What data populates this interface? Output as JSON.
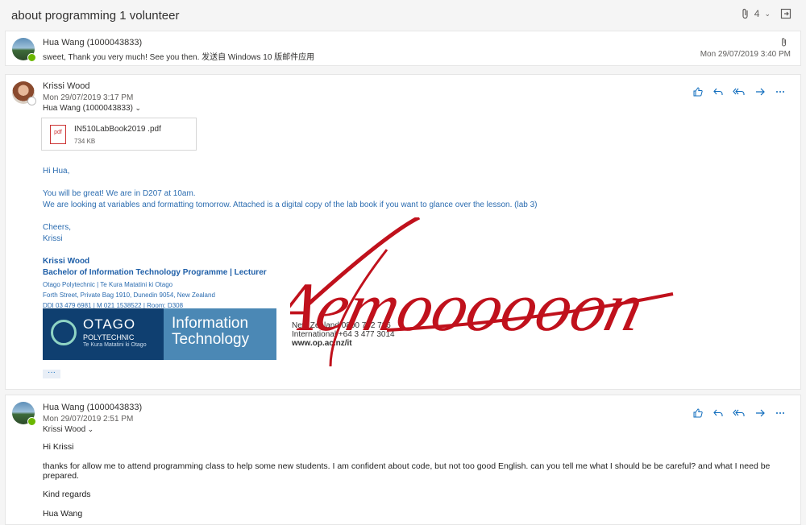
{
  "subject": "about programming 1 volunteer",
  "thread": {
    "attachment_count": "4",
    "attachment_icon": "paperclip-icon",
    "popout_icon": "popout-icon"
  },
  "message1": {
    "sender": "Hua Wang (1000043833)",
    "preview": "sweet, Thank you very much! See you then. 发送自 Windows 10 版邮件应用",
    "date": "Mon 29/07/2019 3:40 PM"
  },
  "message2": {
    "sender": "Krissi Wood",
    "date": "Mon 29/07/2019 3:17 PM",
    "to": "Hua Wang (1000043833)",
    "attachment": {
      "name": "IN510LabBook2019 .pdf",
      "size": "734 KB",
      "icon_text": "pdf"
    },
    "greeting": "Hi Hua,",
    "line1": "You will be great! We are in D207 at 10am.",
    "line2": "We are looking at variables and formatting tomorrow. Attached is a digital copy of the lab book if you want to glance over the lesson. (lab 3)",
    "closing": "Cheers,",
    "closing_name": "Krissi",
    "signature": {
      "name": "Krissi Wood",
      "role": "Bachelor of Information Technology Programme | Lecturer",
      "org": "Otago Polytechnic | Te Kura Matatini ki Otago",
      "address": "Forth Street, Private Bag 1910, Dunedin 9054, New Zealand",
      "phones": "DDI 03 479 6981  | M 021 1538522  | Room: D308",
      "banner_left_title": "OTAGO",
      "banner_left_sub": "POLYTECHNIC",
      "banner_left_sub2": "Te Kura Matatini ki Otago",
      "banner_right_line1": "Information",
      "banner_right_line2": "Technology",
      "contact_nz": "New Zealand 0800 762 786",
      "contact_intl": "International +64 3 477 3014",
      "contact_web": "www.op.ac.nz/it"
    },
    "more": "···"
  },
  "message3": {
    "sender": "Hua Wang (1000043833)",
    "date": "Mon 29/07/2019 2:51 PM",
    "to": "Krissi Wood",
    "greeting": "Hi Krissi",
    "body": "thanks for allow me to attend programming class to help some new students. I am confident about code, but not too good English.  can you tell me what I should be be careful?  and what I need be prepared.",
    "regards": "Kind regards",
    "name": "Hua Wang"
  },
  "actions": {
    "like": "like-icon",
    "reply": "reply-icon",
    "reply_all": "reply-all-icon",
    "forward": "forward-icon",
    "more": "more-icon"
  },
  "watermark_text": "Aemoooooon",
  "colors": {
    "accent": "#0f6cbd",
    "body_text": "#2b6cb0",
    "watermark": "#c0111c"
  }
}
